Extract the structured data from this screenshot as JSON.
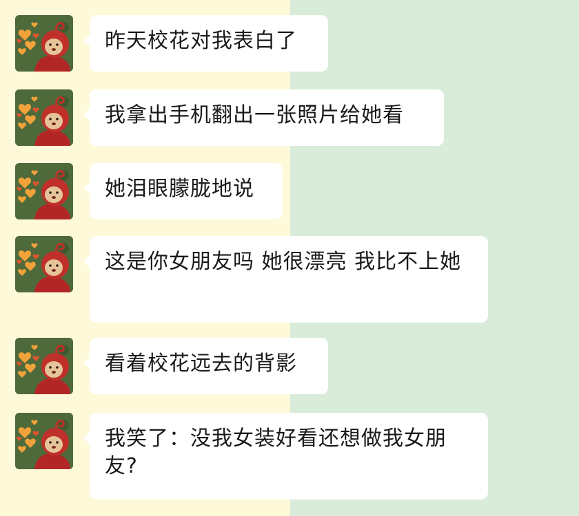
{
  "colors": {
    "left_background": "#fdf9d9",
    "right_background": "#d8ecd9",
    "bubble": "#ffffff",
    "text": "#1a1a1a"
  },
  "avatar_icon": "red-teletubby-with-orange-hearts",
  "messages": [
    {
      "text": "昨天校花对我表白了"
    },
    {
      "text": "我拿出手机翻出一张照片给她看"
    },
    {
      "text": "她泪眼朦胧地说"
    },
    {
      "text": "这是你女朋友吗 她很漂亮 我比不上她"
    },
    {
      "text": "看着校花远去的背影"
    },
    {
      "text": "我笑了：没我女装好看还想做我女朋友?"
    }
  ]
}
